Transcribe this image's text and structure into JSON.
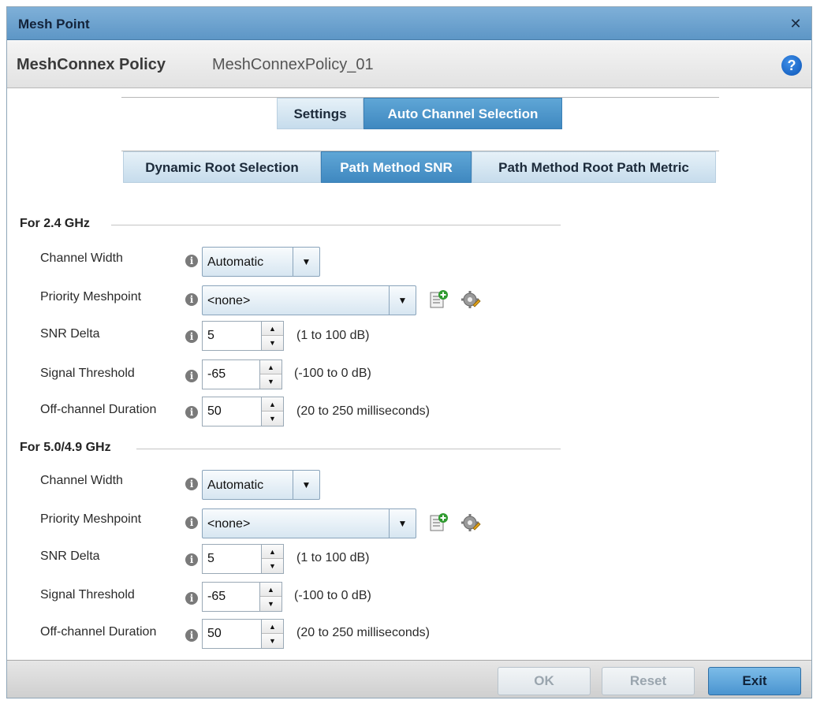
{
  "window": {
    "title": "Mesh Point",
    "close_icon": "close-icon"
  },
  "header": {
    "label": "MeshConnex Policy",
    "value": "MeshConnexPolicy_01"
  },
  "tabs_primary": [
    {
      "label": "Settings",
      "active": false
    },
    {
      "label": "Auto Channel Selection",
      "active": true
    }
  ],
  "tabs_secondary": [
    {
      "label": "Dynamic Root Selection",
      "active": false
    },
    {
      "label": "Path Method SNR",
      "active": true
    },
    {
      "label": "Path Method Root Path Metric",
      "active": false
    }
  ],
  "sections": [
    {
      "title": "For 2.4 GHz",
      "channel_width": {
        "label": "Channel Width",
        "value": "Automatic"
      },
      "priority_meshpoint": {
        "label": "Priority Meshpoint",
        "value": "<none>"
      },
      "snr_delta": {
        "label": "SNR Delta",
        "value": "5",
        "range": "(1 to 100 dB)"
      },
      "signal_threshold": {
        "label": "Signal Threshold",
        "value": "-65",
        "range": "(-100 to 0 dB)"
      },
      "off_channel_duration": {
        "label": "Off-channel Duration",
        "value": "50",
        "range": "(20 to 250 milliseconds)"
      }
    },
    {
      "title": "For 5.0/4.9 GHz",
      "channel_width": {
        "label": "Channel Width",
        "value": "Automatic"
      },
      "priority_meshpoint": {
        "label": "Priority Meshpoint",
        "value": "<none>"
      },
      "snr_delta": {
        "label": "SNR Delta",
        "value": "5",
        "range": "(1 to 100 dB)"
      },
      "signal_threshold": {
        "label": "Signal Threshold",
        "value": "-65",
        "range": "(-100 to 0 dB)"
      },
      "off_channel_duration": {
        "label": "Off-channel Duration",
        "value": "50",
        "range": "(20 to 250 milliseconds)"
      }
    }
  ],
  "footer": {
    "ok_label": "OK",
    "reset_label": "Reset",
    "exit_label": "Exit"
  },
  "colors": {
    "title_bar": "#5d96c6",
    "active_tab": "#3f88c0",
    "inactive_tab": "#c6dcec",
    "help": "#0b55b8"
  }
}
